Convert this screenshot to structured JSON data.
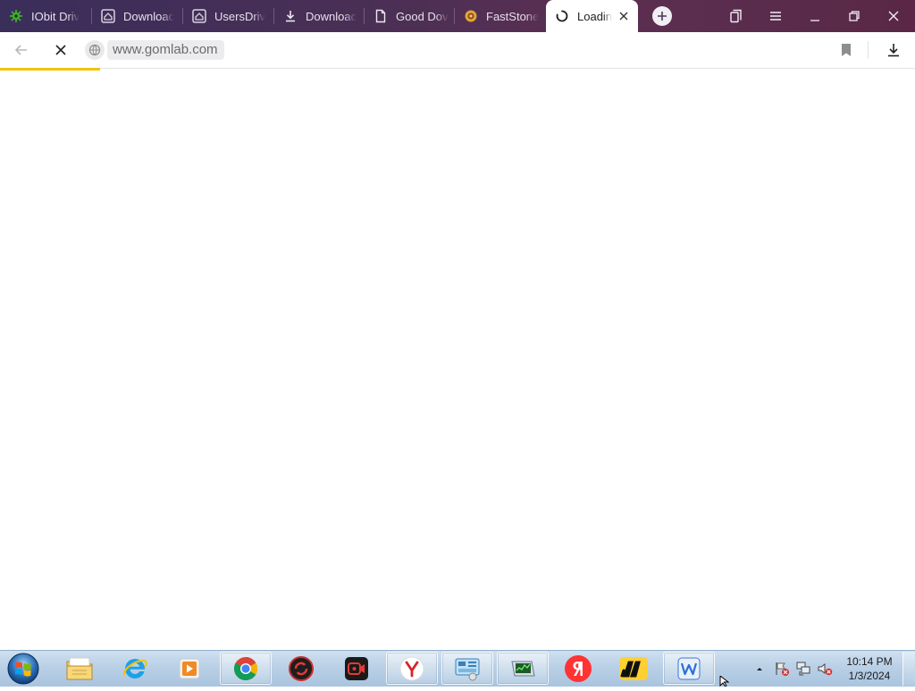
{
  "browser": {
    "tabs": [
      {
        "label": "IObit Driv",
        "icon": "iobit-icon"
      },
      {
        "label": "Downloac",
        "icon": "page-icon"
      },
      {
        "label": "UsersDriv",
        "icon": "page-icon"
      },
      {
        "label": "Downloac",
        "icon": "download-icon"
      },
      {
        "label": "Good Dov",
        "icon": "document-icon"
      },
      {
        "label": "FastStone",
        "icon": "faststone-icon"
      },
      {
        "label": "Loadin",
        "icon": "spinner-icon",
        "active": true
      }
    ],
    "address": {
      "url": "www.gomlab.com"
    },
    "accent_color": "#f2c300"
  },
  "taskbar": {
    "apps": [
      "windows-explorer",
      "internet-explorer",
      "media-player",
      "chrome",
      "iobit-driver-booster",
      "screen-recorder",
      "yandex-browser",
      "control-panel",
      "task-manager",
      "yandex",
      "miro",
      "wps-writer"
    ],
    "clock": {
      "time": "10:14 PM",
      "date": "1/3/2024"
    }
  }
}
